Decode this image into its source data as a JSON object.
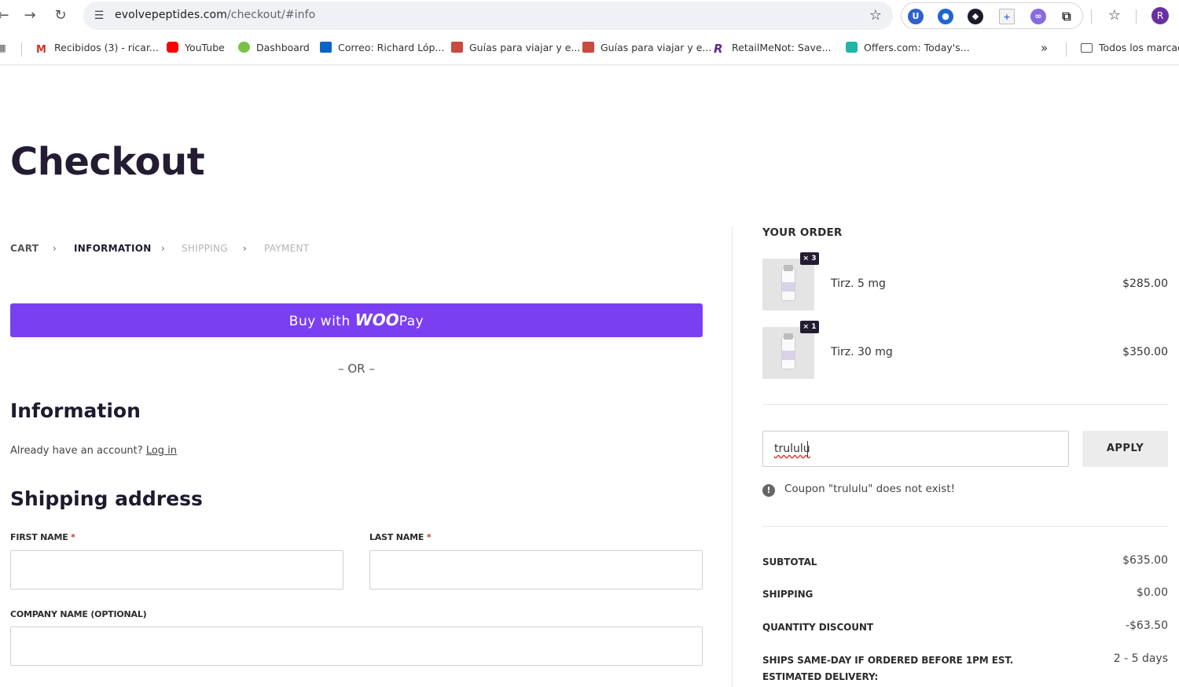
{
  "browser": {
    "url_host": "evolvepeptides.com",
    "url_path": "/checkout/#info",
    "profile_initial": "R",
    "bookmarks": [
      {
        "label": "Recibidos (3) - ricar...",
        "icon": "gmail-icon"
      },
      {
        "label": "YouTube",
        "icon": "youtube-icon"
      },
      {
        "label": "Dashboard",
        "icon": "dashboard-icon"
      },
      {
        "label": "Correo: Richard Lóp...",
        "icon": "outlook-icon"
      },
      {
        "label": "Guías para viajar y e...",
        "icon": "travel-guide-icon"
      },
      {
        "label": "Guías para viajar y e...",
        "icon": "travel-guide-icon"
      },
      {
        "label": "RetailMeNot: Save...",
        "icon": "retailmenot-icon"
      },
      {
        "label": "Offers.com: Today's...",
        "icon": "offers-icon"
      }
    ],
    "overflow_chevron": "»",
    "all_bookmarks_label": "Todos los marcad"
  },
  "page": {
    "title": "Checkout",
    "breadcrumb": {
      "cart": "CART",
      "information": "INFORMATION",
      "shipping": "SHIPPING",
      "payment": "PAYMENT",
      "separator": "›"
    },
    "woopay": {
      "prefix": "Buy with",
      "brand_woo": "WOO",
      "brand_pay": "Pay",
      "color": "#7b3ff2"
    },
    "or_divider": "– OR –",
    "information_heading": "Information",
    "account_prompt": "Already have an account?",
    "login_link": "Log in",
    "shipping_heading": "Shipping address",
    "fields": {
      "first_name_label": "FIRST NAME",
      "last_name_label": "LAST NAME",
      "company_label": "COMPANY NAME (OPTIONAL)",
      "required_mark": "*",
      "first_name_value": "",
      "last_name_value": "",
      "company_value": ""
    }
  },
  "order": {
    "title": "YOUR ORDER",
    "items": [
      {
        "name": "Tirz. 5 mg",
        "qty": "× 3",
        "price": "$285.00"
      },
      {
        "name": "Tirz. 30 mg",
        "qty": "× 1",
        "price": "$350.00"
      }
    ],
    "coupon": {
      "value": "trululu",
      "apply_label": "APPLY",
      "error": "Coupon \"trululu\" does not exist!"
    },
    "totals": {
      "subtotal_label": "SUBTOTAL",
      "subtotal": "$635.00",
      "shipping_label": "SHIPPING",
      "shipping": "$0.00",
      "discount_label": "QUANTITY DISCOUNT",
      "discount": "-$63.50",
      "delivery_label_1": "SHIPS SAME-DAY IF ORDERED BEFORE 1PM EST.",
      "delivery_label_2": "ESTIMATED DELIVERY:",
      "delivery": "2 - 5 days"
    }
  }
}
